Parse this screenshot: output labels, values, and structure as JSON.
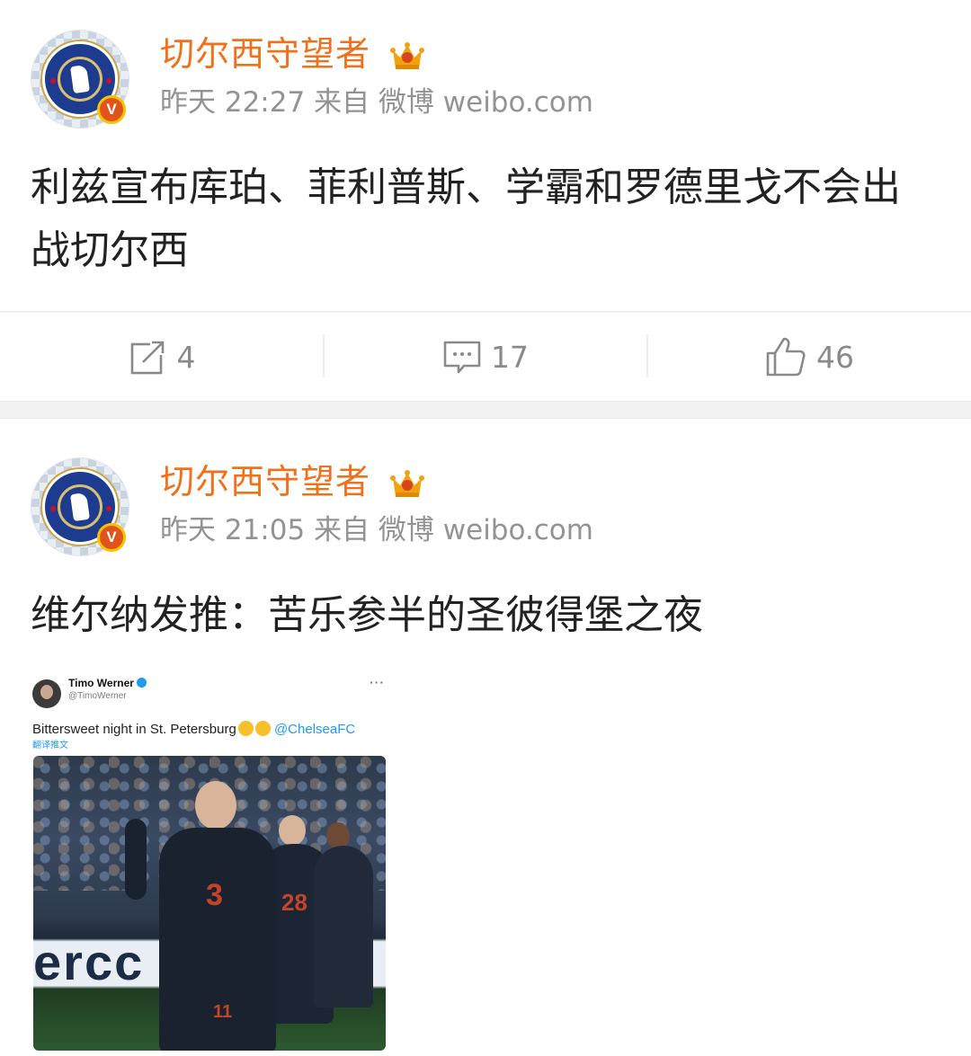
{
  "posts": [
    {
      "author": "切尔西守望者",
      "time": "昨天 22:27",
      "source": "来自 微博 weibo.com",
      "verified_badge": "V",
      "content": "利兹宣布库珀、菲利普斯、学霸和罗德里戈不会出战切尔西",
      "actions": {
        "repost": "4",
        "comment": "17",
        "like": "46"
      }
    },
    {
      "author": "切尔西守望者",
      "time": "昨天 21:05",
      "source": "来自 微博 weibo.com",
      "verified_badge": "V",
      "content": "维尔纳发推：苦乐参半的圣彼得堡之夜",
      "embedded_tweet": {
        "name": "Timo Werner",
        "handle": "@TimoWerner",
        "more": "···",
        "text": "Bittersweet night in St. Petersburg",
        "mention": "@ChelseaFC",
        "translate": "翻译推文",
        "photo_text": "ercc",
        "jersey_numbers": [
          "11",
          "28"
        ]
      }
    }
  ],
  "colors": {
    "author": "#f0701c",
    "meta": "#939393",
    "link": "#1d9bf0",
    "badge": "#e0541c"
  },
  "icons": {
    "repost": "repost-icon",
    "comment": "comment-icon",
    "like": "thumbs-up-icon",
    "level": "crown-level-icon"
  }
}
